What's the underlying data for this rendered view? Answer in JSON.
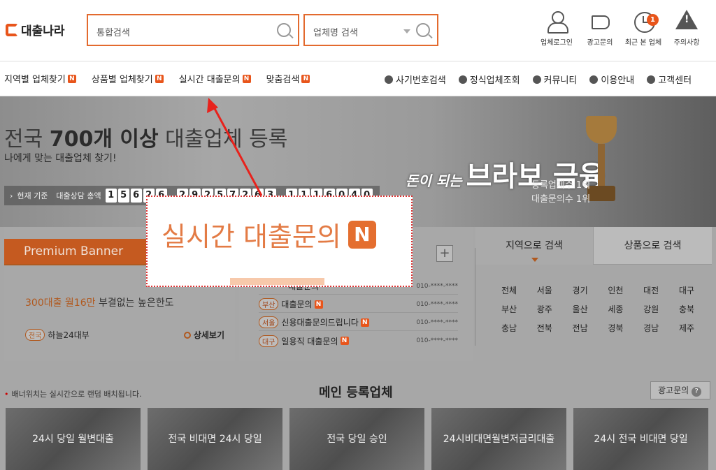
{
  "header": {
    "logo": "대출나라",
    "search_placeholder": "통합검색",
    "company_search_placeholder": "업체명 검색",
    "icons": [
      {
        "label": "업체로그인",
        "icon": "user-icon"
      },
      {
        "label": "광고문의",
        "icon": "megaphone-icon"
      },
      {
        "label": "최근 본 업체",
        "icon": "clock-icon",
        "badge": "1"
      },
      {
        "label": "주의사항",
        "icon": "warning-icon"
      }
    ]
  },
  "nav": {
    "left": [
      "지역별 업체찾기",
      "상품별 업체찾기",
      "실시간 대출문의",
      "맞춤검색"
    ],
    "right": [
      "사기번호검색",
      "정식업체조회",
      "커뮤니티",
      "이용안내",
      "고객센터"
    ],
    "new_badge": "N"
  },
  "hero": {
    "title_pre": "전국 ",
    "title_bold": "700개 이상",
    "title_post": " 대출업체 등록",
    "subtitle": "나에게 맞는 대출업체 찾기!",
    "slogan_small": "돈이 되는",
    "slogan_big": "브라보 금융",
    "award1": "등록업체수 1위",
    "award2": "대출문의수 1위",
    "stats_label1": "현재 기준",
    "stats_label2": "대출상담 총액",
    "stats_digits1": [
      "1",
      "5",
      "6",
      "2",
      "6"
    ],
    "stats_digits2": [
      "2",
      "9",
      "2",
      "5",
      "7",
      "2",
      "6",
      "3"
    ],
    "stats_digits3": [
      "1",
      "1",
      "1",
      "6",
      "0",
      "4",
      "0"
    ]
  },
  "premium": {
    "tab": "Premium Banner",
    "headline_or": "300대출 월16만",
    "headline_rest": " 부결없는 높은한도",
    "region": "전국",
    "company": "하늘24대부",
    "more": "상세보기"
  },
  "realtime": {
    "rows": [
      {
        "region": "",
        "title": "대출문의",
        "phone": "010-****-****"
      },
      {
        "region": "부산",
        "title": "대출문의",
        "phone": "010-****-****"
      },
      {
        "region": "서울",
        "title": "신용대출문의드립니다",
        "phone": "010-****-****"
      },
      {
        "region": "대구",
        "title": "일용직 대출문의",
        "phone": "010-****-****"
      }
    ]
  },
  "regions": {
    "tab1": "지역으로 검색",
    "tab2": "상품으로 검색",
    "rows": [
      [
        "전체",
        "서울",
        "경기",
        "인천",
        "대전",
        "대구"
      ],
      [
        "부산",
        "광주",
        "울산",
        "세종",
        "강원",
        "충북"
      ],
      [
        "충남",
        "전북",
        "전남",
        "경북",
        "경남",
        "제주"
      ]
    ]
  },
  "main": {
    "notice": "배너위치는 실시간으로 랜덤 배치됩니다.",
    "title": "메인 등록업체",
    "ad_button": "광고문의",
    "cards": [
      "24시 당일 월변대출",
      "전국 비대면 24시 당일",
      "전국 당일 승인",
      "24시비대면월변저금리대출",
      "24시 전국 비대면 당일"
    ]
  },
  "zoom": {
    "text": "실시간 대출문의",
    "badge": "N"
  }
}
